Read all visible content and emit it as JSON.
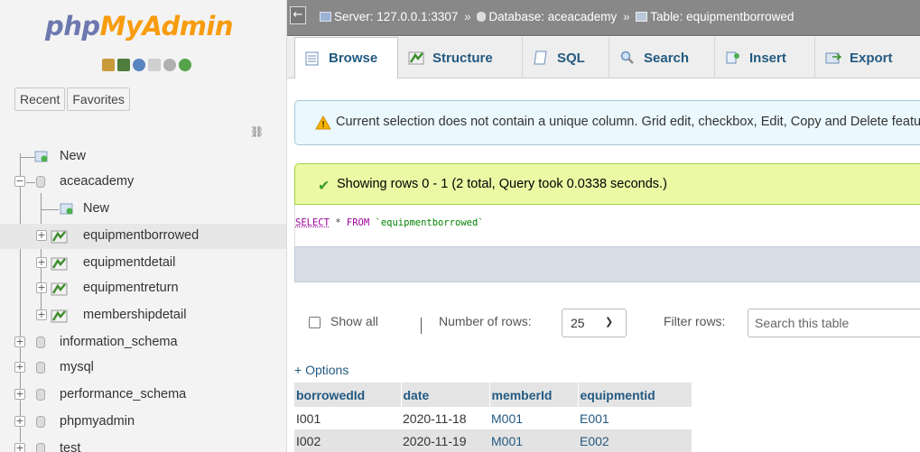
{
  "logo": {
    "part1": "php",
    "part2": "MyAdmin"
  },
  "nav": {
    "tabs": {
      "recent": "Recent",
      "favorites": "Favorites"
    },
    "tree": {
      "new_root": "New",
      "db_aceacademy": "aceacademy",
      "new_table": "New",
      "tables": [
        "equipmentborrowed",
        "equipmentdetail",
        "equipmentreturn",
        "membershipdetail"
      ],
      "other_dbs": [
        "information_schema",
        "mysql",
        "performance_schema",
        "phpmyadmin",
        "test"
      ]
    }
  },
  "breadcrumb": {
    "server": "Server: 127.0.0.1:3307",
    "database": "Database: aceacademy",
    "table": "Table: equipmentborrowed"
  },
  "menu": {
    "browse": "Browse",
    "structure": "Structure",
    "sql": "SQL",
    "search": "Search",
    "insert": "Insert",
    "export": "Export"
  },
  "messages": {
    "warning": "Current selection does not contain a unique column. Grid edit, checkbox, Edit, Copy and Delete features are not available.",
    "success": "Showing rows 0 - 1 (2 total, Query took 0.0338 seconds.)"
  },
  "query": {
    "select": "SELECT",
    "star": " * ",
    "from": "FROM",
    "table": " `equipmentborrowed`"
  },
  "controls": {
    "show_all": "Show all",
    "number_of_rows_label": "Number of rows:",
    "number_of_rows_value": "25",
    "filter_label": "Filter rows:",
    "filter_placeholder": "Search this table"
  },
  "options_link": "+ Options",
  "table": {
    "headers": [
      "borrowedId",
      "date",
      "memberId",
      "equipmentid"
    ],
    "rows": [
      [
        "I001",
        "2020-11-18",
        "M001",
        "E001"
      ],
      [
        "I002",
        "2020-11-19",
        "M001",
        "E002"
      ]
    ]
  },
  "colors": {
    "accent": "#235a81",
    "logo_php": "#6c78af",
    "logo_myadmin": "#f89c0e",
    "success_bg": "#ebf8a4",
    "warning_bg": "#ebf8fd"
  }
}
